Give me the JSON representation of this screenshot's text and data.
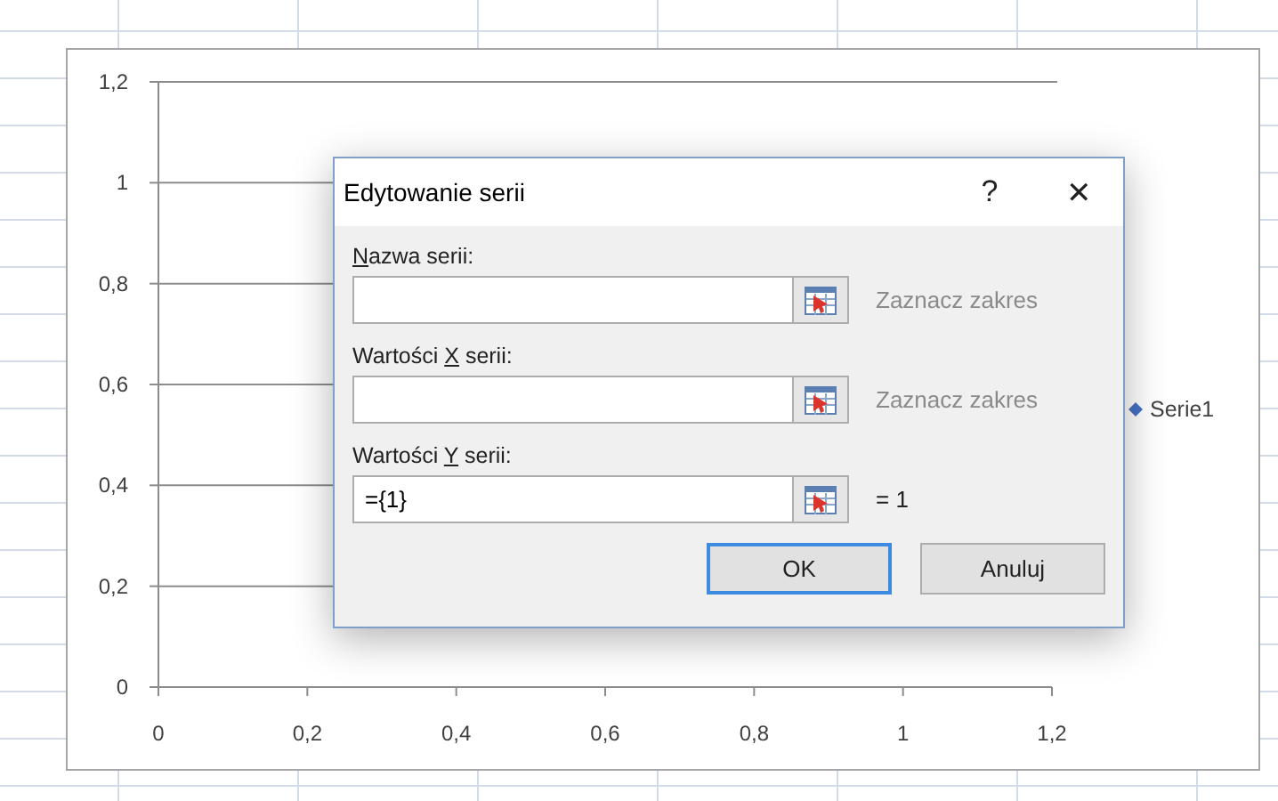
{
  "chart": {
    "chart_data": {
      "type": "scatter",
      "grid": true,
      "ylim": [
        0,
        1.2
      ],
      "categories": [
        "0",
        "0,2",
        "0,4",
        "0,6",
        "0,8",
        "1",
        "1,2"
      ],
      "yticks": [
        {
          "value": 0,
          "label": "0"
        },
        {
          "value": 0.2,
          "label": "0,2"
        },
        {
          "value": 0.4,
          "label": "0,4"
        },
        {
          "value": 0.6,
          "label": "0,6"
        },
        {
          "value": 0.8,
          "label": "0,8"
        },
        {
          "value": 1,
          "label": "1"
        },
        {
          "value": 1.2,
          "label": "1,2"
        }
      ],
      "series": [
        {
          "name": "Serie1",
          "color": "#4472c4",
          "values": [
            null,
            null,
            null,
            null,
            null,
            null,
            null
          ]
        }
      ]
    }
  },
  "dialog": {
    "title": "Edytowanie serii",
    "help": "?",
    "close": "✕",
    "fields": [
      {
        "access_key": "N",
        "label_rest": "azwa serii:",
        "hint": "Zaznacz zakres",
        "hint_disabled": true
      },
      {
        "label_start": "Wartości ",
        "access_key": "X",
        "label_rest": " serii:",
        "hint": "Zaznacz zakres",
        "hint_disabled": true
      },
      {
        "label_start": "Wartości ",
        "access_key": "Y",
        "label_rest": " serii:",
        "value": "={1}",
        "hint": "= 1",
        "hint_disabled": false
      }
    ],
    "buttons": [
      {
        "label": "OK",
        "focused": true
      },
      {
        "label": "Anuluj",
        "focused": false
      }
    ]
  }
}
